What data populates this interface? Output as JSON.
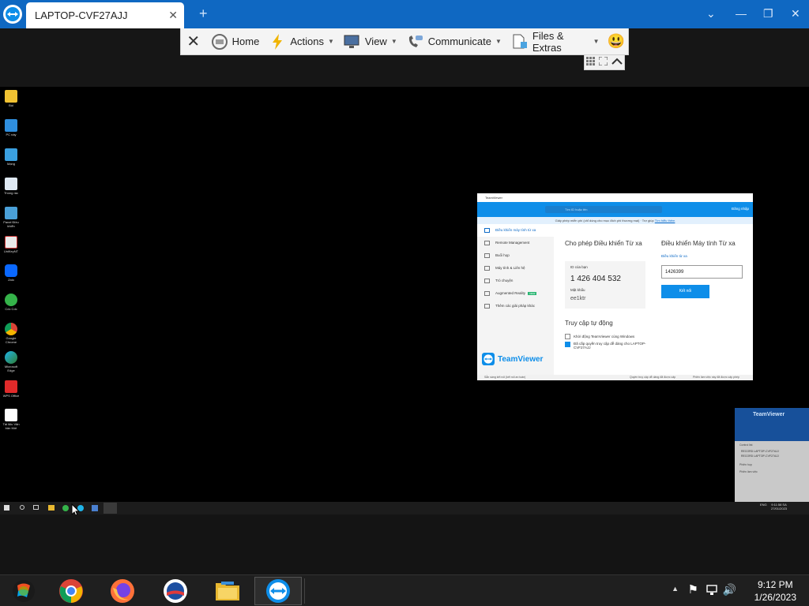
{
  "window": {
    "tab_title": "LAPTOP-CVF27AJJ",
    "tab_close_glyph": "✕",
    "new_tab_glyph": "+",
    "minimize_glyph": "—",
    "restore_glyph": "❐",
    "close_glyph": "✕",
    "chevron_glyph": "⌄"
  },
  "toolbar": {
    "close_glyph": "✕",
    "home_label": "Home",
    "actions_label": "Actions",
    "view_label": "View",
    "communicate_label": "Communicate",
    "files_label": "Files & Extras",
    "caret": "▼",
    "smiley": "😃"
  },
  "remote_desktop": {
    "icons": [
      {
        "label": "Bùi"
      },
      {
        "label": "PC này"
      },
      {
        "label": "Mạng"
      },
      {
        "label": "Thùng rác"
      },
      {
        "label": "Panel Điều khiển"
      },
      {
        "label": "UniKeyNT"
      },
      {
        "label": "Zalo"
      },
      {
        "label": "Cốc Cốc"
      },
      {
        "label": "Google Chrome"
      },
      {
        "label": "Microsoft Edge"
      },
      {
        "label": "WPS Office"
      },
      {
        "label": "Tài liệu Văn bản Mới"
      }
    ],
    "remote_teamviewer": {
      "title": "TeamViewer",
      "search_placeholder": "Tìm ID hoặc tên",
      "signin_label": "Đăng nhập",
      "notice": "Giấy phép miễn phí (chỉ dùng cho mục đích phi thương mại) · Trợ giúp",
      "notice_link": "Tìm hiểu thêm",
      "sidebar": [
        "Điều khiển máy tính từ xa",
        "Remote Management",
        "Buổi họp",
        "Máy tính & Liên hệ",
        "Trò chuyện",
        "Augmented Reality",
        "Thêm các giải pháp khác"
      ],
      "new_badge": "NEW",
      "allow_title": "Cho phép Điều khiển Từ xa",
      "id_label": "ID của bạn",
      "id_value": "1 426 404 532",
      "pw_label": "Mật khẩu",
      "pw_value": "ee1ktr",
      "control_title": "Điều khiển Máy tính Từ xa",
      "partner_mode": "Điều khiển từ xa",
      "partner_id": "1426399",
      "connect_label": "Kết nối",
      "auto_title": "Truy cập tự động",
      "auto_opt1": "Khởi động TeamViewer cùng Windows",
      "auto_opt2": "Đã cấp quyền truy cập dễ dàng cho LAPTOP-CVF27AJJ",
      "brand": "TeamViewer",
      "status_left": "Sẵn sàng kết nối (kết nối an toàn)",
      "status_mid": "Quyền truy cập dễ dàng đã được cấp",
      "status_right": "Phiên làm việc này đã được cấp phép"
    },
    "mini_panel": {
      "brand": "TeamViewer",
      "line1": "Control list",
      "row1": "RECORD LAPTOP-CVF27AJJ",
      "row2": "RECORD LAPTOP-CVF27AJJ",
      "section2": "Phiên họp",
      "input": "Phiên làm việc"
    },
    "taskbar": {
      "clock_time": "9:11:58 SA",
      "clock_date": "27/01/2023",
      "lang": "ENG"
    }
  },
  "local_taskbar": {
    "clock_time": "9:12 PM",
    "clock_date": "1/26/2023",
    "tray_up": "▲",
    "flag": "⚑",
    "speaker": "🔊"
  },
  "colors": {
    "titlebar": "#0f68c2",
    "teamviewer_blue": "#0e8ee9",
    "taskbar": "#1f1f1f"
  }
}
